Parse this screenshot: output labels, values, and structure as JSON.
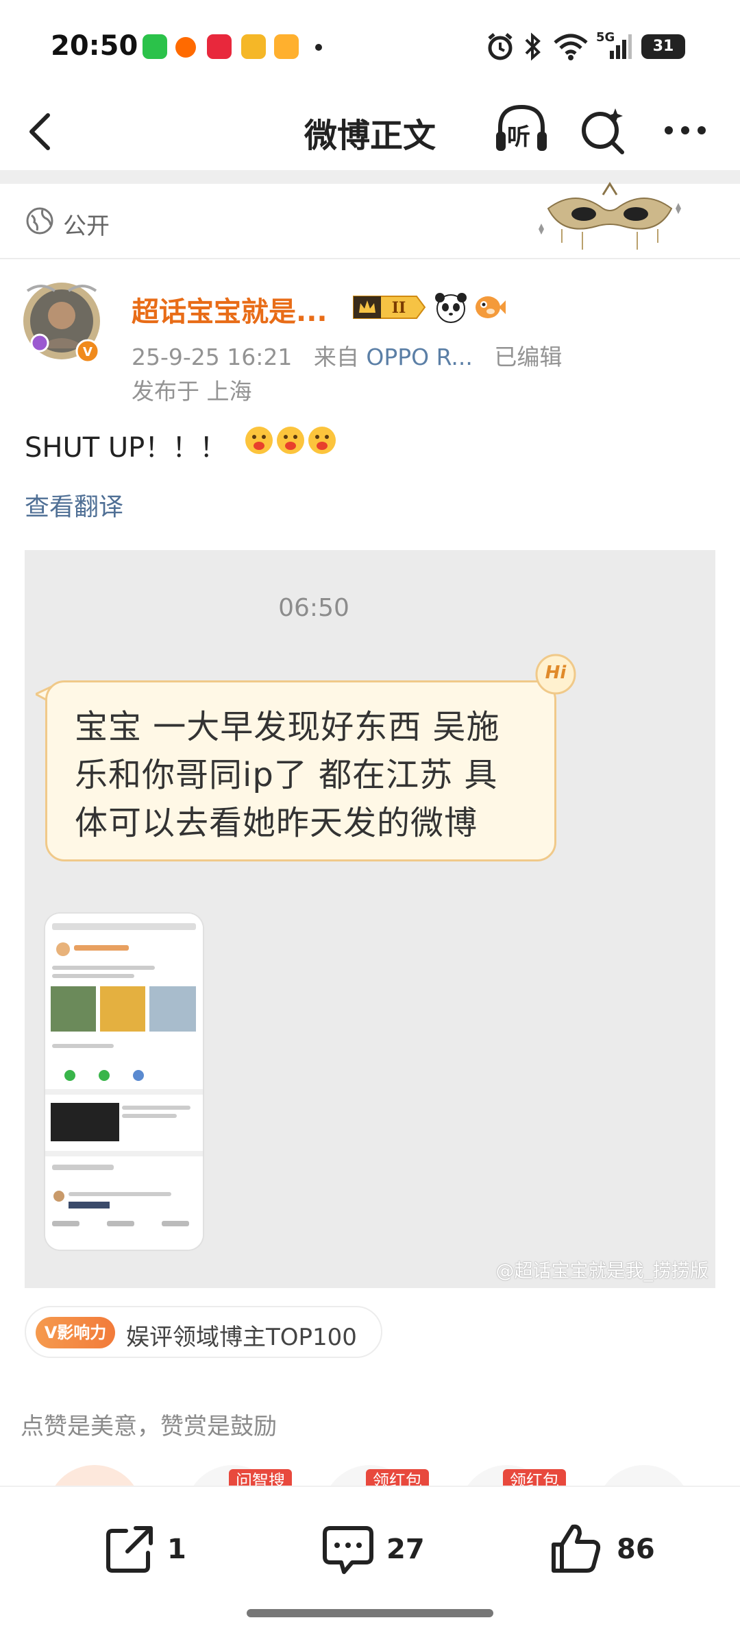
{
  "status_bar": {
    "time": "20:50",
    "network": "5G",
    "battery": "31",
    "app_icons": [
      "wechat-icon",
      "taobao-icon",
      "xiaohongshu-icon",
      "weibo-icon",
      "video-icon"
    ]
  },
  "nav": {
    "title": "微博正文",
    "listen_label": "听"
  },
  "post": {
    "visibility": "公开",
    "author": {
      "name": "超话宝宝就是...",
      "level_badge": "II"
    },
    "meta": {
      "datetime": "25-9-25 16:21",
      "source_prefix": "来自",
      "source": "OPPO R...",
      "edited": "已编辑",
      "location": "发布于 上海"
    },
    "text": "SHUT UP！！！",
    "translate_label": "查看翻译",
    "image": {
      "chat_time": "06:50",
      "bubble_text": "宝宝 一大早发现好东西 吴施乐和你哥同ip了 都在江苏 具体可以去看她昨天发的微博",
      "bubble_badge": "Hi",
      "watermark": "@超话宝宝就是我_捞捞版"
    },
    "influence": {
      "tag": "V影响力",
      "text": "娱评领域博主TOP100"
    }
  },
  "reward": {
    "text": "点赞是美意，赞赏是鼓励",
    "tags": [
      "问智搜",
      "领红包",
      "领红包"
    ]
  },
  "actions": {
    "share_count": "1",
    "comment_count": "27",
    "like_count": "86"
  },
  "colors": {
    "author_name": "#e86c17",
    "link": "#4f6f95",
    "bubble_bg": "#fff8e6",
    "bubble_border": "#f0c989"
  }
}
